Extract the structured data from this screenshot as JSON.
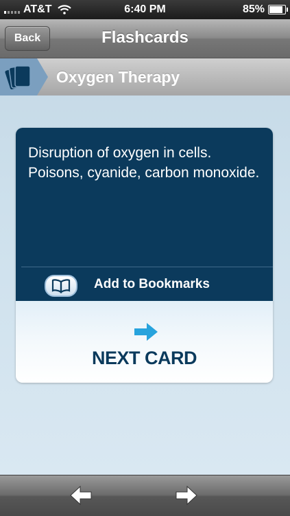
{
  "status_bar": {
    "carrier": "AT&T",
    "time": "6:40 PM",
    "battery": "85%"
  },
  "nav": {
    "back_label": "Back",
    "title": "Flashcards"
  },
  "section": {
    "title": "Oxygen Therapy",
    "icon": "flashcards-stack-icon"
  },
  "card": {
    "text": "Disruption of oxygen in cells. Poisons, cyanide, carbon monoxide.",
    "bookmark_label": "Add to Bookmarks",
    "bookmark_icon": "open-book-icon",
    "next_label": "NEXT CARD",
    "next_icon": "right-arrow-icon"
  },
  "toolbar": {
    "prev_icon": "left-arrow-icon",
    "next_icon": "right-arrow-icon"
  },
  "colors": {
    "card_dark": "#0b3a5c",
    "accent_arrow": "#27a3dd",
    "section_icon_bg": "#7b9fbf"
  }
}
